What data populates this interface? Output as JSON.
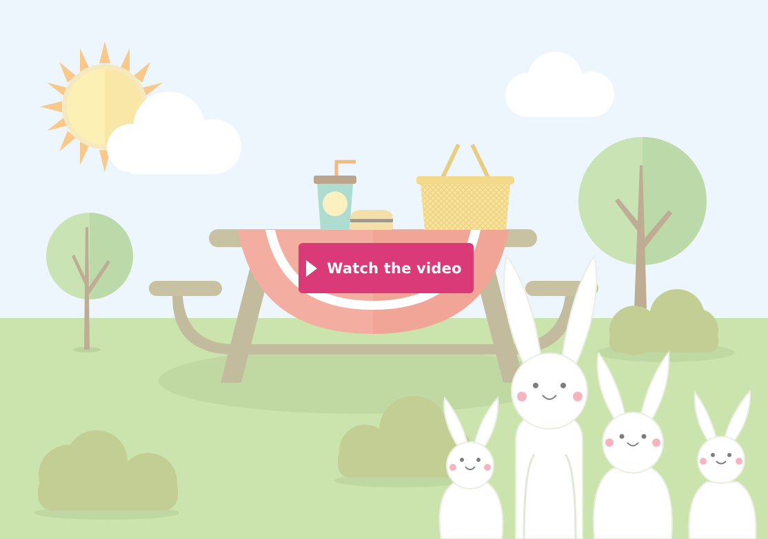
{
  "video_button": {
    "label": "Watch the video",
    "icon": "play-icon",
    "color": "#db3a78"
  },
  "scene": {
    "illustration": "picnic-illustration",
    "colors": {
      "sky": "#eef6fd",
      "grass": "#cbe3ad",
      "sun": "#fdeeb6",
      "sun_rays": "#f9c98b",
      "tree_leaves": "#c7e2b3",
      "bush": "#c2ce93",
      "table": "#c9c2a2",
      "blanket": "#f4aea1",
      "bunny": "#ffffff",
      "basket": "#f6e29a"
    }
  }
}
